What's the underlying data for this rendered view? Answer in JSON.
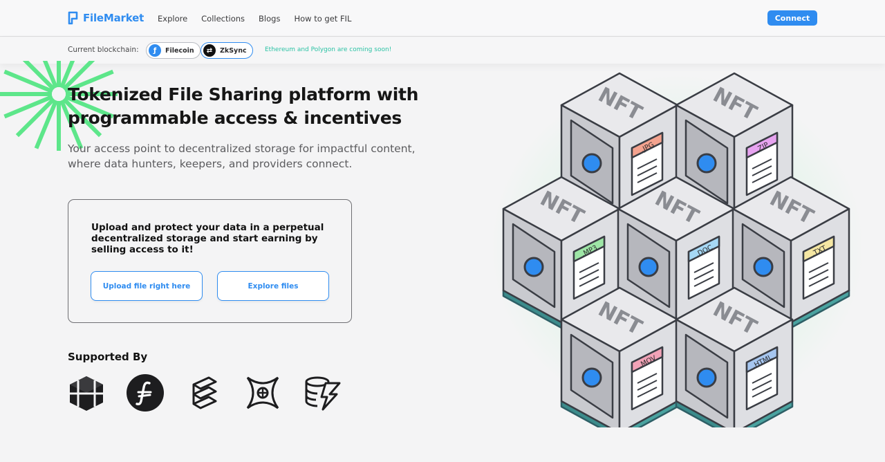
{
  "header": {
    "logo_text": "FileMarket",
    "nav": [
      "Explore",
      "Collections",
      "Blogs",
      "How to get FIL"
    ],
    "connect_label": "Connect"
  },
  "chain_bar": {
    "label": "Current blockchain:",
    "chains": [
      {
        "name": "Filecoin",
        "icon": "filecoin-icon",
        "color": "#2f8cf0"
      },
      {
        "name": "ZkSync",
        "icon": "zksync-icon",
        "color": "#111111"
      }
    ],
    "coming_soon": "Ethereum and Polygon are coming soon!"
  },
  "hero": {
    "title": "Tokenized File Sharing platform with programmable access & incentives",
    "subtitle": "Your access point to decentralized storage for impactful content, where data hunters, keepers, and providers connect."
  },
  "card": {
    "text": "Upload and protect your data in a perpetual decentralized storage and start earning by selling access to it!",
    "upload_label": "Upload file right here",
    "explore_label": "Explore files"
  },
  "supported": {
    "title": "Supported By",
    "logos": [
      "cube-logo-icon",
      "filecoin-logo-icon",
      "layered-logo-icon",
      "crossed-logo-icon",
      "stack-bolt-logo-icon"
    ]
  },
  "illustration": {
    "block_label": "NFT",
    "files": [
      ".JPG",
      ".ZIP",
      ".MP3",
      ".DOC",
      ".TXT",
      ".MOV",
      ".HTML"
    ],
    "tag_colors": [
      "#f4a38f",
      "#e7a3f0",
      "#9ee6a6",
      "#a6d8f5",
      "#f5e7a3",
      "#f2a3b7",
      "#a6c6f0"
    ]
  },
  "theme": {
    "accent": "#2f8cf0",
    "success": "#2bc2a4",
    "burst": "#5de68a"
  }
}
